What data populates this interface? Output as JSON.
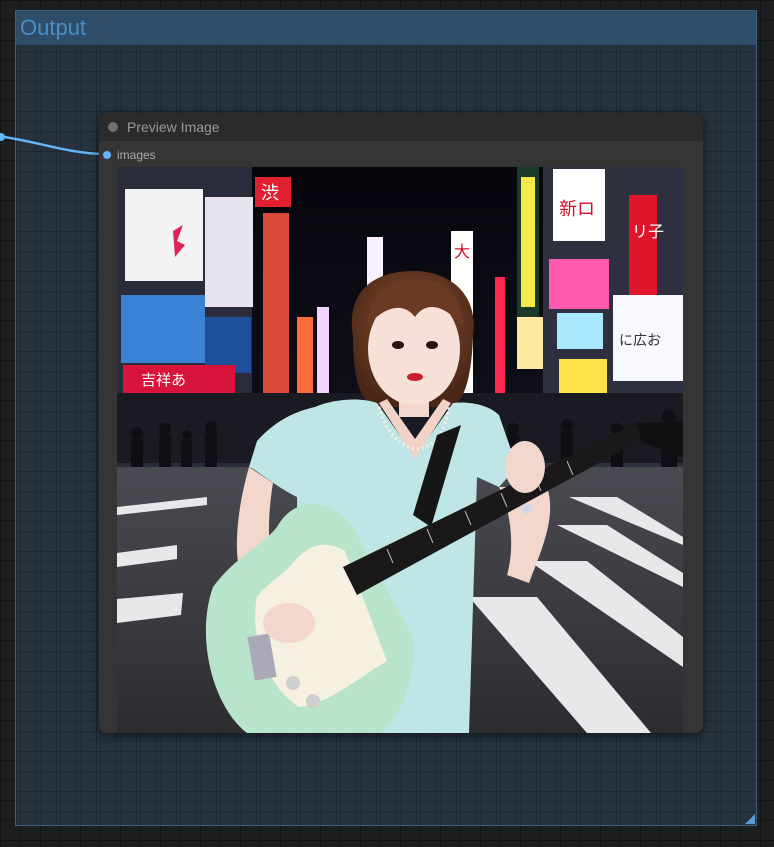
{
  "group": {
    "title": "Output"
  },
  "node": {
    "title": "Preview Image",
    "input_slot": "images"
  },
  "image": {
    "signs": {
      "top_red": "渋",
      "center_white": "大",
      "right_white": "新ロ",
      "right_red": "リ子",
      "right_bottom": "に広お",
      "left_red": "吉祥あ"
    }
  },
  "colors": {
    "accent": "#64b5f6",
    "group_title": "#4a8ec7",
    "node_bg": "#353535",
    "guitar_body": "#b9e4cc",
    "dress": "#bfe6e6"
  }
}
